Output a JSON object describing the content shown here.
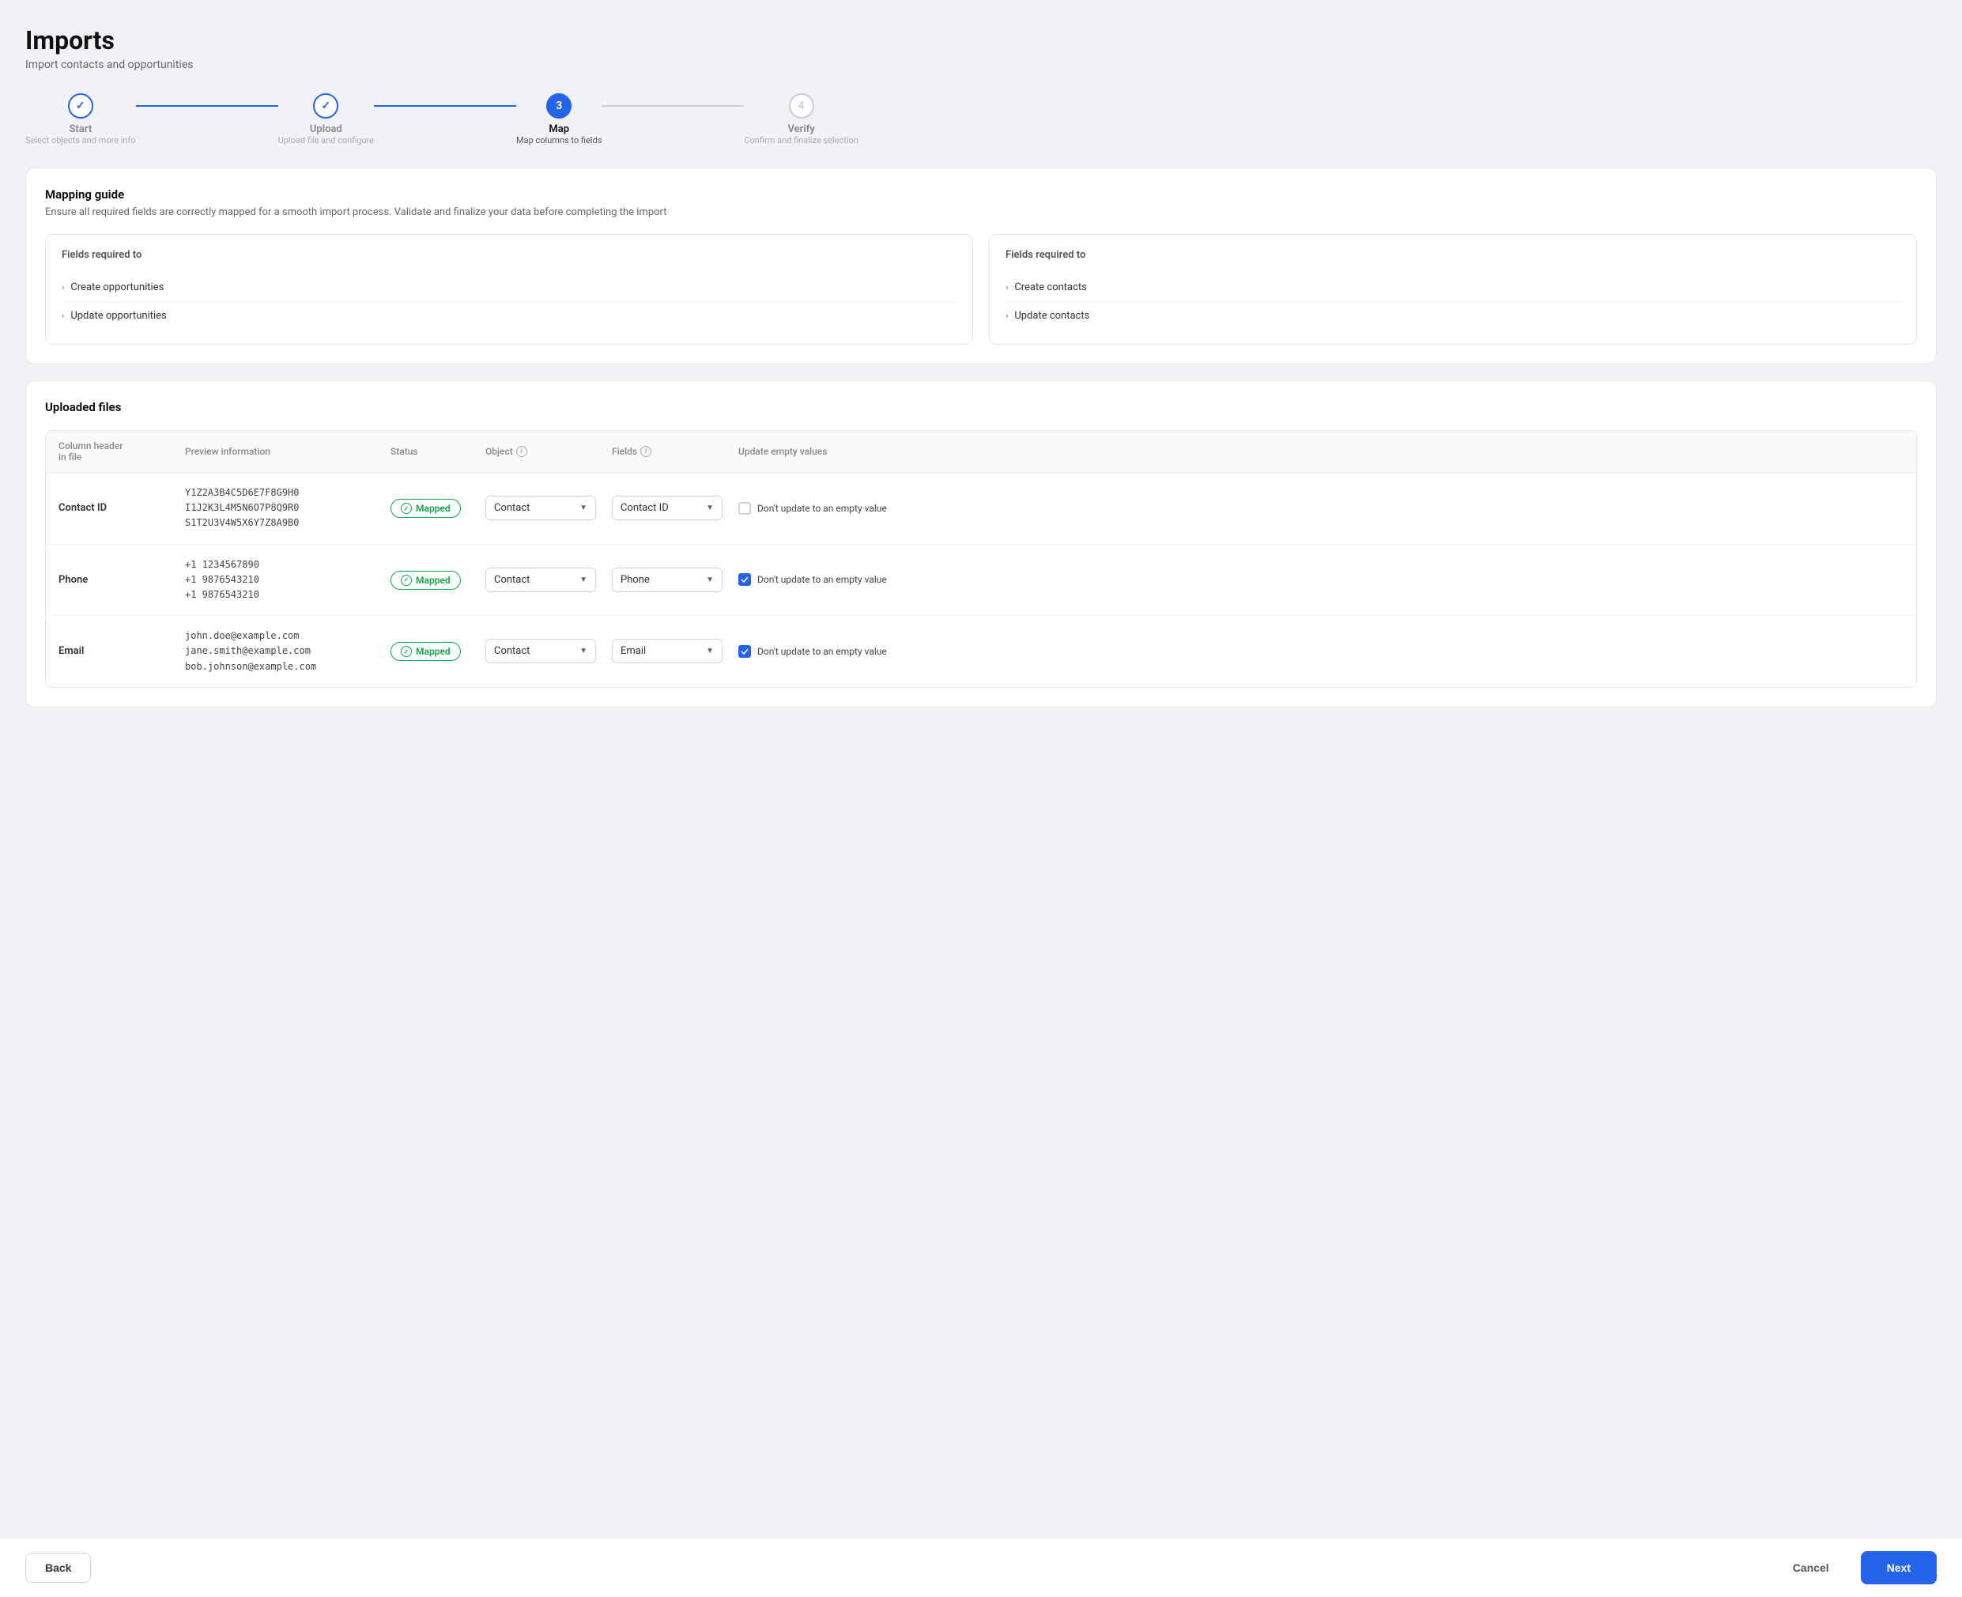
{
  "page": {
    "title": "Imports",
    "subtitle": "Import contacts and opportunities"
  },
  "stepper": {
    "steps": [
      {
        "id": "start",
        "number": "✓",
        "label": "Start",
        "desc": "Select objects and more info",
        "state": "done"
      },
      {
        "id": "upload",
        "number": "✓",
        "label": "Upload",
        "desc": "Upload file and configure",
        "state": "done"
      },
      {
        "id": "map",
        "number": "3",
        "label": "Map",
        "desc": "Map columns to fields",
        "state": "active"
      },
      {
        "id": "verify",
        "number": "4",
        "label": "Verify",
        "desc": "Confirm and finalize selection",
        "state": "pending"
      }
    ],
    "lines": [
      "done",
      "done",
      "pending"
    ]
  },
  "mapping_guide": {
    "title": "Mapping guide",
    "desc": "Ensure all required fields are correctly mapped for a smooth import process. Validate and finalize your data before completing the import",
    "boxes": [
      {
        "title": "Fields required to",
        "items": [
          {
            "label": "Create opportunities"
          },
          {
            "label": "Update opportunities"
          }
        ]
      },
      {
        "title": "Fields required to",
        "items": [
          {
            "label": "Create contacts"
          },
          {
            "label": "Update contacts"
          }
        ]
      }
    ]
  },
  "uploaded_files": {
    "title": "Uploaded files",
    "table": {
      "headers": [
        {
          "label": "Column header\nin file",
          "icon": false
        },
        {
          "label": "Preview information",
          "icon": false
        },
        {
          "label": "Status",
          "icon": false
        },
        {
          "label": "Object",
          "icon": true
        },
        {
          "label": "Fields",
          "icon": true
        },
        {
          "label": "Update empty values",
          "icon": false
        }
      ],
      "rows": [
        {
          "column_name": "Contact ID",
          "preview": "Y1Z2A3B4C5D6E7F8G9H0\nI1J2K3L4M5N6O7P8Q9R0\nS1T2U3V4W5X6Y7Z8A9B0",
          "status": "Mapped",
          "object": "Contact",
          "field": "Contact ID",
          "update_empty": false,
          "update_empty_label": "Don't update to an empty value"
        },
        {
          "column_name": "Phone",
          "preview": "+1 1234567890\n+1 9876543210\n+1 9876543210",
          "status": "Mapped",
          "object": "Contact",
          "field": "Phone",
          "update_empty": true,
          "update_empty_label": "Don't update to an empty value"
        },
        {
          "column_name": "Email",
          "preview": "john.doe@example.com\njane.smith@example.com\nbob.johnson@example.com",
          "status": "Mapped",
          "object": "Contact",
          "field": "Email",
          "update_empty": true,
          "update_empty_label": "Don't update to an empty value"
        }
      ]
    }
  },
  "footer": {
    "back_label": "Back",
    "cancel_label": "Cancel",
    "next_label": "Next"
  }
}
